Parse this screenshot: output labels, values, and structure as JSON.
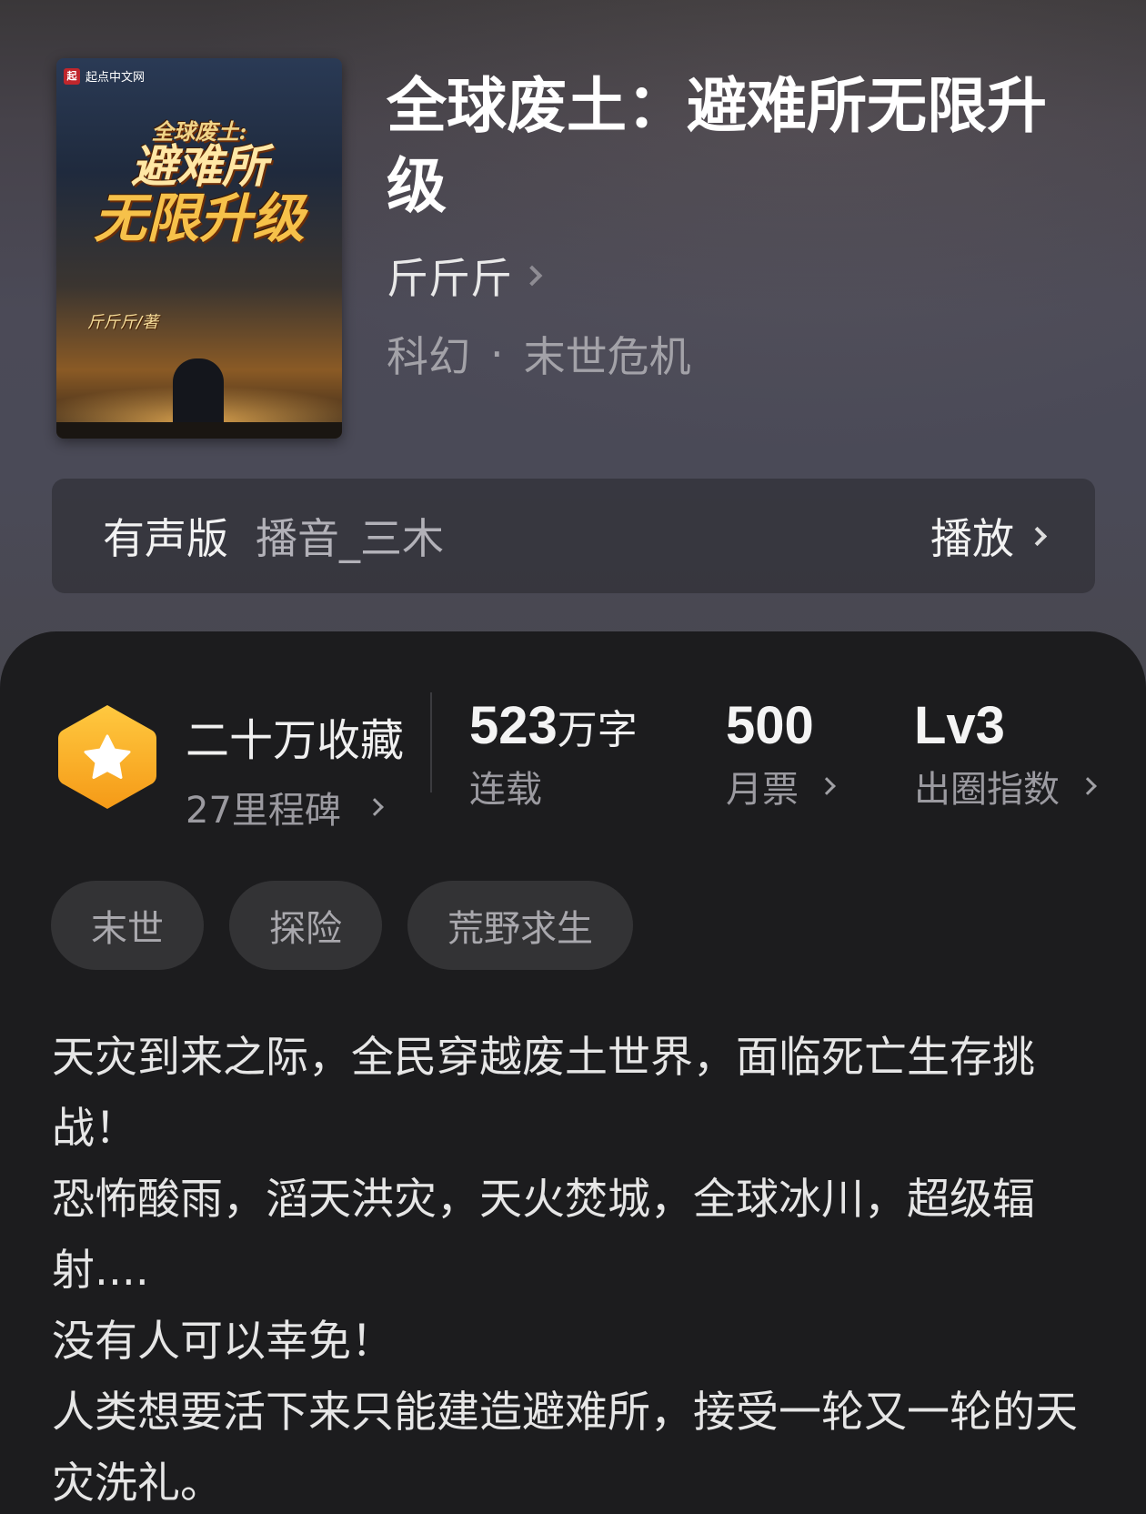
{
  "book": {
    "cover": {
      "publisher": "起点中文网",
      "publisher_logo": "起",
      "title_line1": "全球废土:",
      "title_line2": "避难所",
      "title_line3": "无限升级",
      "author_credit": "斤斤斤/著"
    },
    "title": "全球废土：避难所无限升级",
    "author": "斤斤斤",
    "category": "科幻",
    "separator": "·",
    "subcategory": "末世危机"
  },
  "audio": {
    "label": "有声版",
    "narrator": "播音_三木",
    "play_label": "播放"
  },
  "stats": {
    "favorites": "二十万收藏",
    "milestones": "27里程碑",
    "word_count_number": "523",
    "word_count_unit": "万字",
    "status": "连载",
    "monthly_votes": "500",
    "monthly_votes_label": "月票",
    "level": "Lv3",
    "level_label": "出圈指数"
  },
  "tags": [
    "末世",
    "探险",
    "荒野求生"
  ],
  "description": [
    "天灾到来之际，全民穿越废土世界，面临死亡生存挑战！",
    "恐怖酸雨，滔天洪灾，天火焚城，全球冰川，超级辐射....",
    "没有人可以幸免！",
    "人类想要活下来只能建造避难所，接受一轮又一轮的天灾洗礼。"
  ],
  "colors": {
    "badge_gradient_top": "#FFC940",
    "badge_gradient_bottom": "#F59A17",
    "panel_bg": "#1C1C1E",
    "tag_bg": "#333335"
  }
}
